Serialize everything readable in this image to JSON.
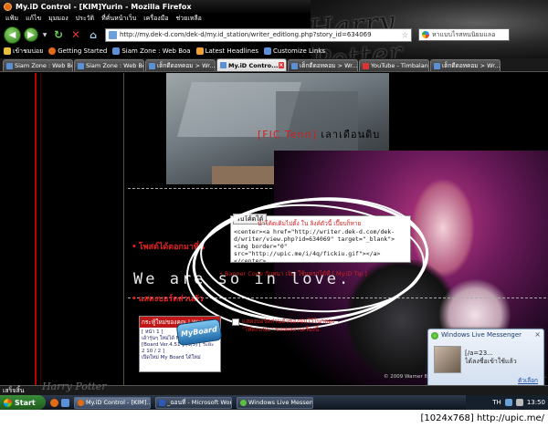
{
  "window": {
    "title": "My.iD Control - [KIM]Yurin - Mozilla Firefox",
    "decor_text": "Harry Potter"
  },
  "menu": [
    "แฟ้ม",
    "แก้ไข",
    "มุมมอง",
    "ประวัติ",
    "ที่คั่นหน้าเว็บ",
    "เครื่องมือ",
    "ช่วยเหลือ"
  ],
  "nav": {
    "url": "http://my.dek-d.com/dek-d/my.id_station/writer_editlong.php?story_id=634069",
    "search_text": "หาแบบไรสหนนิยมแลอ"
  },
  "bookmarks": [
    {
      "label": "เข้าชมบ่อย",
      "color": "#e8c040"
    },
    {
      "label": "Getting Started",
      "color": "#e36b16"
    },
    {
      "label": "Siam Zone : Web Boa",
      "color": "#5b90d6"
    },
    {
      "label": "Latest Headlines",
      "color": "#f0a030"
    },
    {
      "label": "Customize Links",
      "color": "#5b90d6"
    }
  ],
  "tabs": [
    {
      "label": "Siam Zone : Web Bo...",
      "active": false
    },
    {
      "label": "Siam Zone : Web Bo...",
      "active": false
    },
    {
      "label": "เด็กดีดอทคอม > Wr...",
      "active": false
    },
    {
      "label": "My.iD Contro...",
      "active": true
    },
    {
      "label": "เด็กดีดอทคอม > Wr...",
      "active": false
    },
    {
      "label": "YouTube - Timbalan...",
      "active": false
    },
    {
      "label": "เด็กดีดอทคอม > Wr...",
      "active": false
    }
  ],
  "content": {
    "banner_fic": "[FIC Tenn]",
    "banner_title": "เลาเดือนดิบ",
    "sidebar_label_1": "โพสต์ได้ตอกมาที่นี่",
    "sidebar_label_2": "แสดงบอร์ดส่วนตัว",
    "code_tab": "รับโค้ดได้",
    "code_caption": "นำโค้ดเดิมไปตั้ง ใน ลิงค์ตัวนี้ เปี๊ยบก็หาย",
    "code_text": "<center><a href=\"http://writer.dek-d.com/dek-d/writer/view.php?id=634069\" target=\"_blank\"><img border=\"0\" src=\"http://upic.me/i/4q/fickiu.gif\"></a></center>",
    "code_tip": "Banner Code กับหนา เจิญ ใช้แทรกได้ที่ [ My.iD Tip ]",
    "love_text": "We are so in love.",
    "webmas_head": "กระทู้ใหม่ของคุณ | Webmas",
    "webmas_line1": "[ หน้า 1 ]",
    "webmas_line2": "เอ้ารุ่นๆ ใหม่ได้ My Board",
    "webmas_line3": "[Board Ver.4.51 ] (3/5) [ ระยะ 2 10 / 2 ]",
    "webmas_line4": "เปิดใหม่ My Board ได้ใหม่",
    "myboard": "MyBoard",
    "check_text_1": "แสดงบอร์ดส่วนตัวของฉันไว้ในกล่อง",
    "check_text_2": "\"ให้คะแนน\" ของผลงานเรื่องนี้",
    "copyright": "© 2009 Warner Bros. Ent. Harry Potter Publishing Rights © J.K.R."
  },
  "wlm": {
    "title": "Windows Live Messenger",
    "message_1": "[/a=23...",
    "message_2": "ได้ลงชื่อเข้าใช้แล้ว",
    "options": "ตัวเลือก"
  },
  "statusbar": {
    "text": "เสร็จสิ้น",
    "decor": "Harry Potter"
  },
  "taskbar": {
    "start": "Start",
    "tasks": [
      {
        "label": "My.iD Control - [KIM]...",
        "color": "#e36b16",
        "active": true
      },
      {
        "label": "_ฉอนที่ - Microsoft Word",
        "color": "#2a5bb8",
        "active": false
      },
      {
        "label": "Windows Live Messen...",
        "color": "#5fc040",
        "active": false
      }
    ],
    "lang": "TH",
    "clock": "13:50"
  },
  "caption": "[1024x768] http://upic.me/"
}
